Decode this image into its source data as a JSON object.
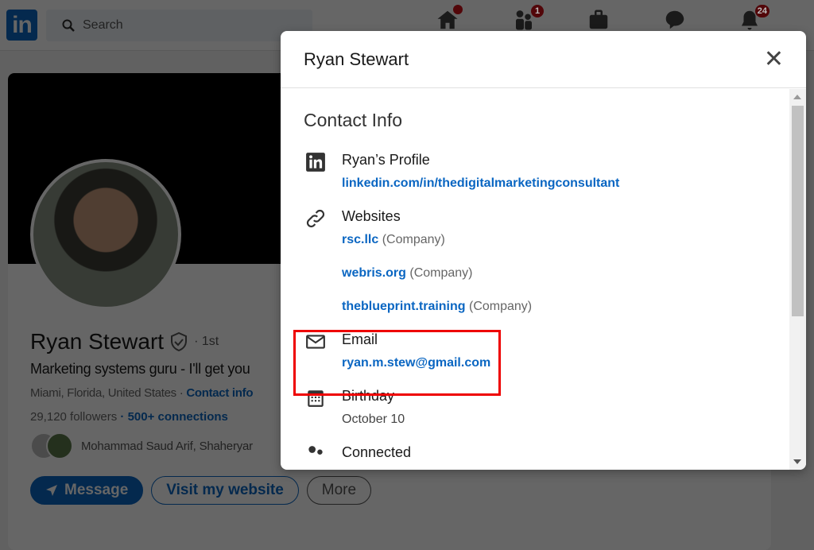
{
  "topbar": {
    "logo": "in",
    "search_placeholder": "Search",
    "nav": [
      {
        "icon": "home-icon",
        "badge": ""
      },
      {
        "icon": "my-network-icon",
        "badge": "1"
      },
      {
        "icon": "jobs-icon",
        "badge": ""
      },
      {
        "icon": "messaging-icon",
        "badge": ""
      },
      {
        "icon": "notifications-icon",
        "badge": "24"
      }
    ]
  },
  "profile": {
    "name": "Ryan Stewart",
    "degree": "· 1st",
    "headline": "Marketing systems guru - I'll get you",
    "location": "Miami, Florida, United States ·",
    "contact_info": "Contact info",
    "followers": "29,120 followers",
    "connections": "· 500+ connections",
    "mutual": "Mohammad Saud Arif, Shaheryar",
    "buttons": {
      "message": "Message",
      "website": "Visit my website",
      "more": "More"
    }
  },
  "modal": {
    "title": "Ryan Stewart",
    "section_title": "Contact Info",
    "profile": {
      "label": "Ryan’s Profile",
      "url": "linkedin.com/in/thedigitalmarketingconsultant"
    },
    "websites": {
      "label": "Websites",
      "items": [
        {
          "url": "rsc.llc",
          "type": "(Company)"
        },
        {
          "url": "webris.org",
          "type": "(Company)"
        },
        {
          "url": "theblueprint.training",
          "type": "(Company)"
        }
      ]
    },
    "email": {
      "label": "Email",
      "value": "ryan.m.stew@gmail.com"
    },
    "birthday": {
      "label": "Birthday",
      "value": "October 10"
    },
    "connected": {
      "label": "Connected"
    }
  },
  "colors": {
    "brand": "#0a66c2",
    "highlight": "#e00000",
    "badge": "#cc1016"
  }
}
